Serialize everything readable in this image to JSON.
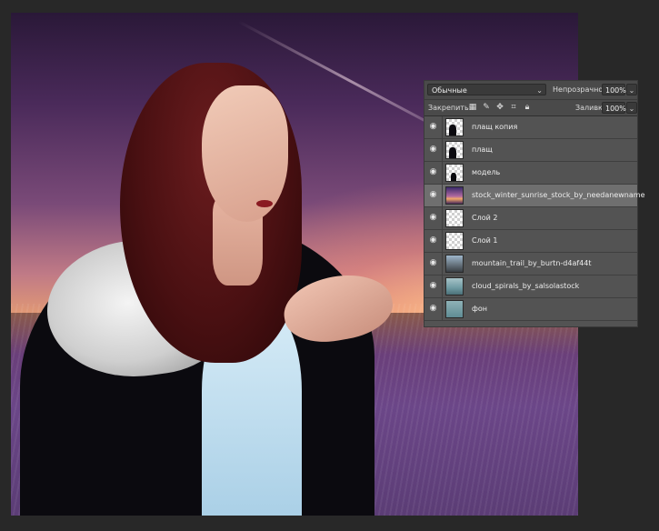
{
  "panel": {
    "blend_mode": "Обычные",
    "opacity_label": "Непрозрачность:",
    "opacity_value": "100%",
    "lock_label": "Закрепить:",
    "fill_label": "Заливка:",
    "fill_value": "100%"
  },
  "icons": {
    "visibility": "eye-icon",
    "lock_transparency": "lock-transparent-pixels-icon",
    "lock_image": "brush-icon",
    "lock_position": "move-icon",
    "artboard": "artboard-icon",
    "lock_all": "lock-icon",
    "dropdown": "chevron-down-icon"
  },
  "layers": [
    {
      "name": "плащ копия",
      "thumb": "transparent-figure",
      "selected": false
    },
    {
      "name": "плащ",
      "thumb": "transparent-figure",
      "selected": false
    },
    {
      "name": "модель",
      "thumb": "transparent-figure-small",
      "selected": false
    },
    {
      "name": "stock_winter_sunrise_stock_by_needanewname",
      "thumb": "purple-landscape",
      "selected": true
    },
    {
      "name": "Слой 2",
      "thumb": "transparent",
      "selected": false
    },
    {
      "name": "Слой 1",
      "thumb": "transparent",
      "selected": false
    },
    {
      "name": "mountain_trail_by_burtn-d4af44t",
      "thumb": "mountain",
      "selected": false
    },
    {
      "name": "cloud_spirals_by_salsolastock",
      "thumb": "clouds",
      "selected": false
    },
    {
      "name": "фон",
      "thumb": "background",
      "selected": false
    }
  ]
}
